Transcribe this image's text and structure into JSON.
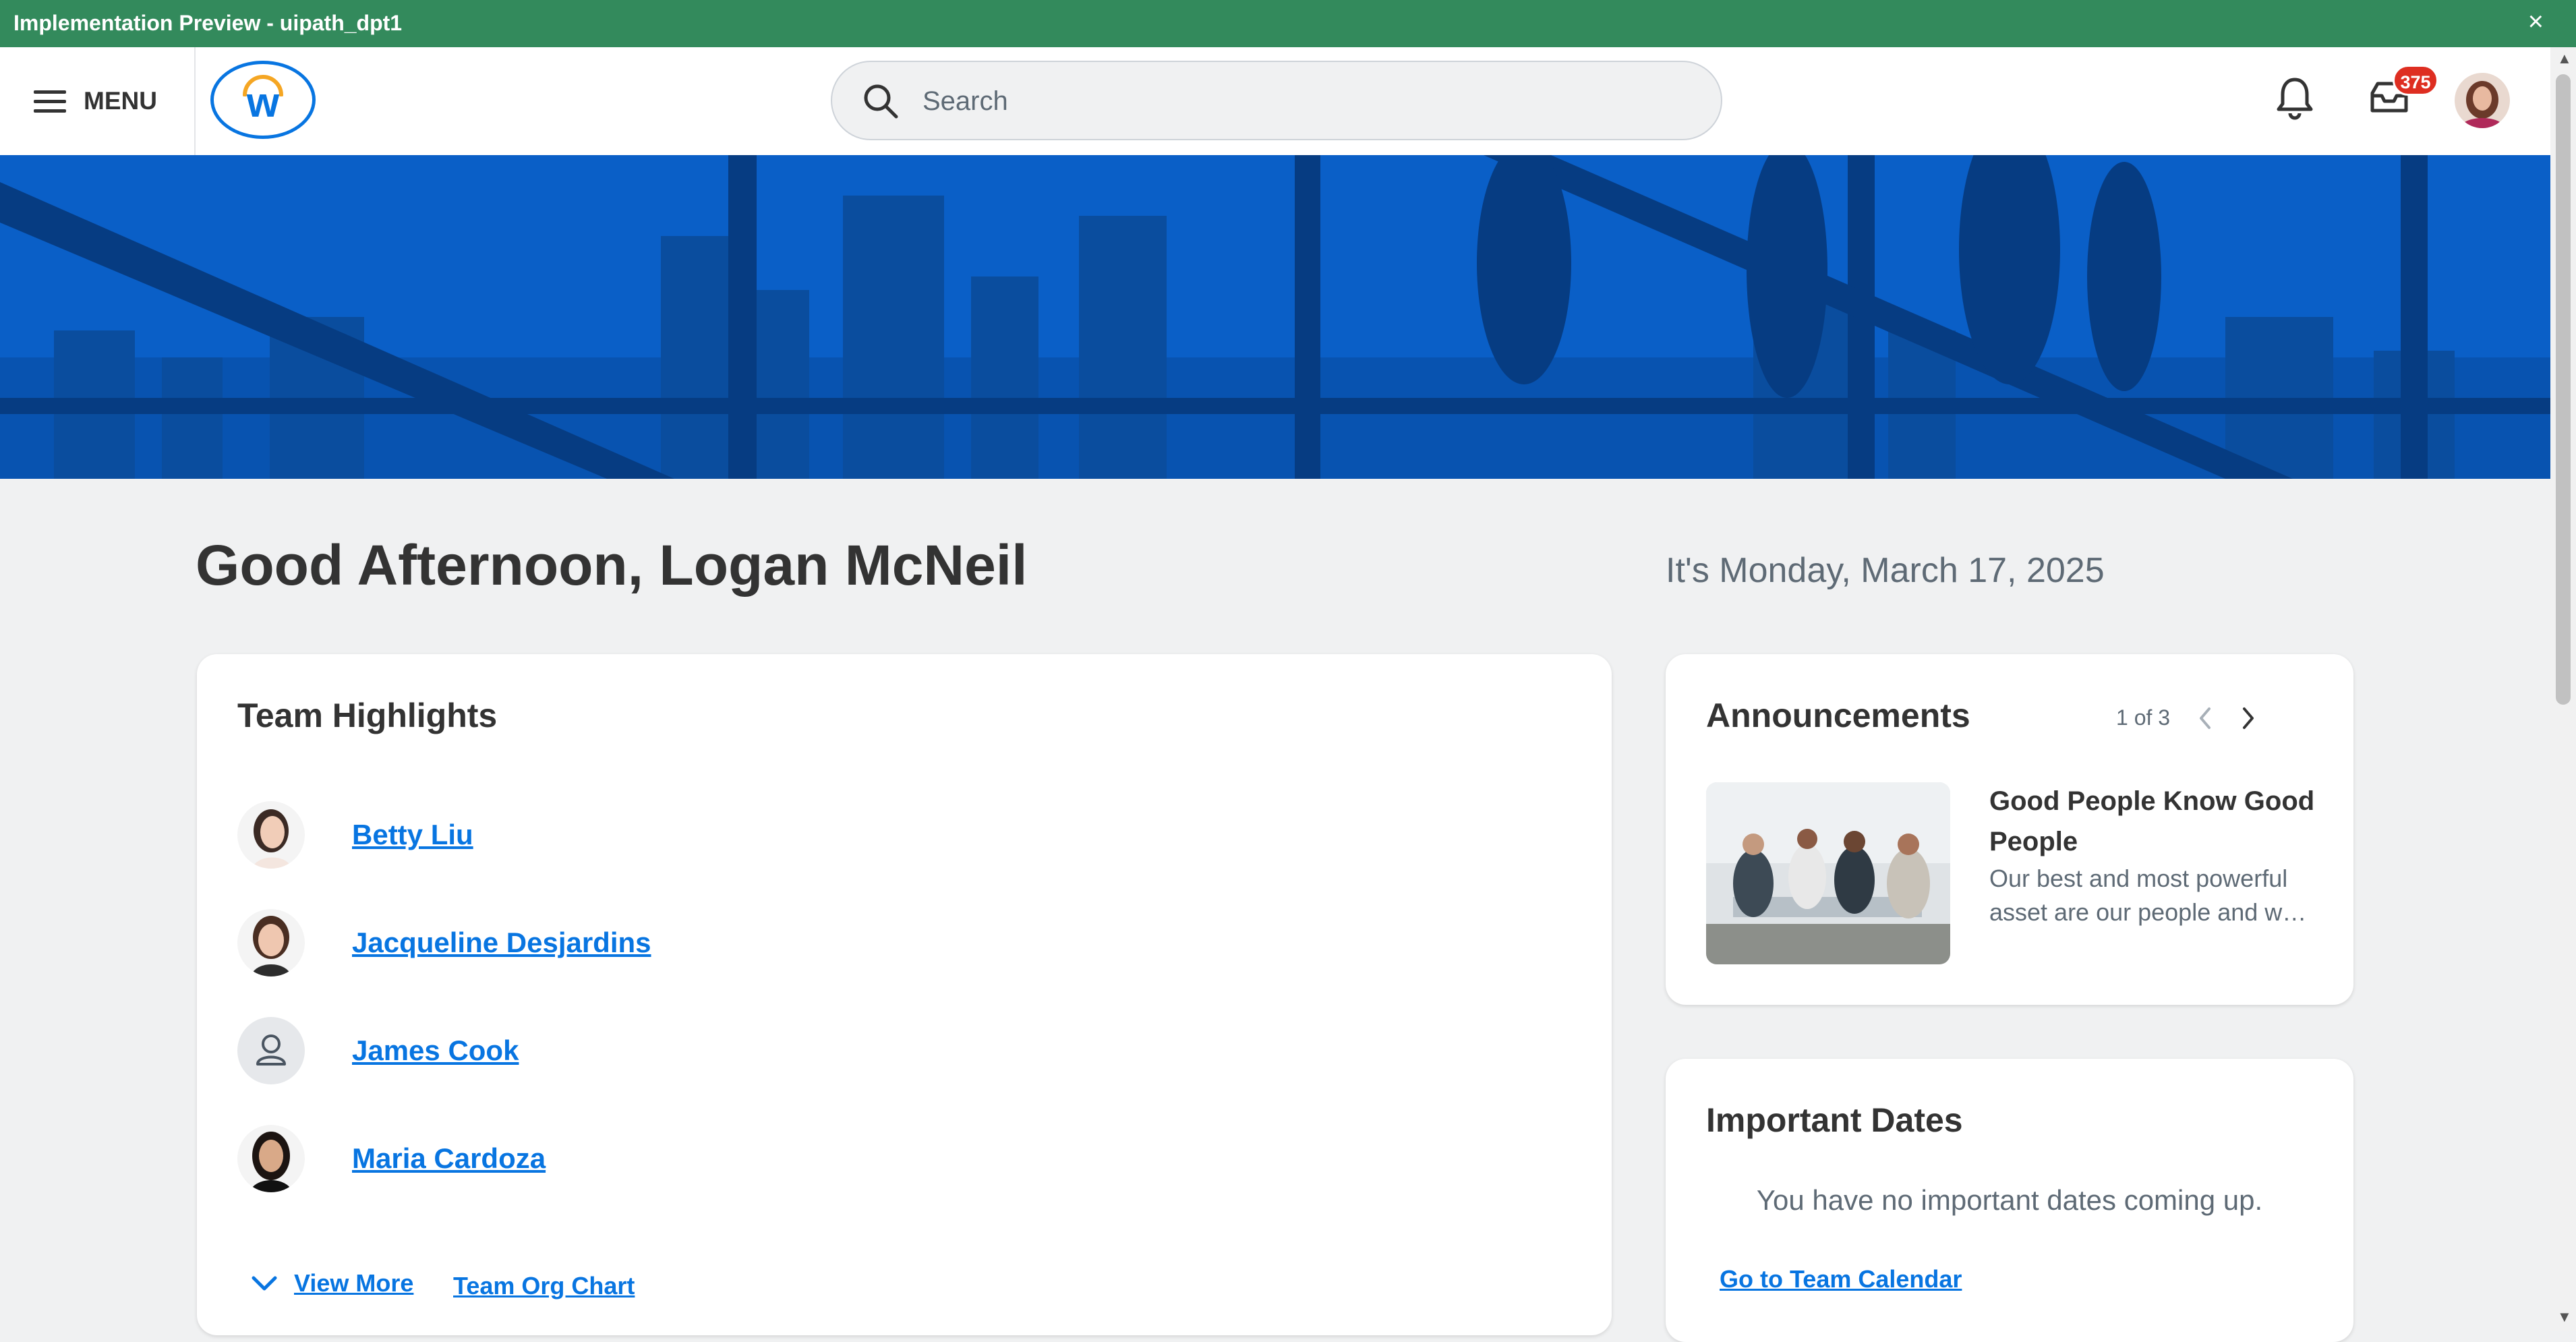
{
  "window": {
    "title": "Implementation Preview - uipath_dpt1",
    "close_glyph": "×"
  },
  "topnav": {
    "menu_label": "MENU",
    "logo_letter": "w",
    "search_placeholder": "Search",
    "search_value": "",
    "inbox_count": "375",
    "icons": [
      "hamburger-icon",
      "workday-logo",
      "search-icon",
      "bell-icon",
      "inbox-icon",
      "user-avatar"
    ]
  },
  "greeting": "Good Afternoon, Logan McNeil",
  "date_text": "It's Monday, March 17, 2025",
  "team_highlights": {
    "title": "Team Highlights",
    "people": [
      {
        "name": "Betty Liu",
        "photo": "photo"
      },
      {
        "name": "Jacqueline Desjardins",
        "photo": "photo"
      },
      {
        "name": "James Cook",
        "photo": "placeholder-user-icon"
      },
      {
        "name": "Maria Cardoza",
        "photo": "photo"
      }
    ],
    "view_more": "View More",
    "org_chart": "Team Org Chart"
  },
  "announcements": {
    "title": "Announcements",
    "counter": "1 of 3",
    "headline": "Good People Know Good People",
    "body": "Our best and most powerful asset are our people and w…"
  },
  "important_dates": {
    "title": "Important Dates",
    "empty_message": "You have no important dates coming up.",
    "calendar_link": "Go to Team Calendar"
  },
  "colors": {
    "env_bar": "#338a5c",
    "brand_blue": "#0875e1",
    "hero_blue": "#0a5fc7",
    "badge_red": "#de2e21",
    "page_bg": "#f0f1f2"
  }
}
